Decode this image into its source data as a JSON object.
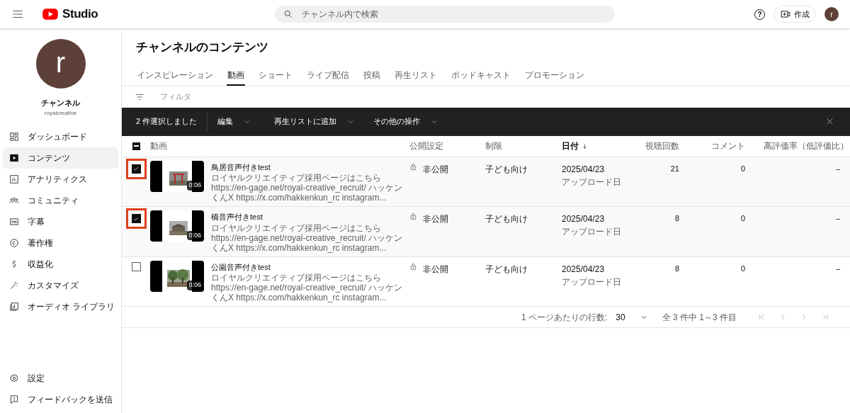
{
  "topbar": {
    "logo": "Studio",
    "search_placeholder": "チャンネル内で検索",
    "help_symbol": "?",
    "create_label": "作成",
    "avatar_letter": "r"
  },
  "channel": {
    "avatar_letter": "r",
    "name": "チャンネル",
    "handle": "royalcreative"
  },
  "sidebar": {
    "items": [
      {
        "label": "ダッシュボード",
        "selected": false
      },
      {
        "label": "コンテンツ",
        "selected": true
      },
      {
        "label": "アナリティクス",
        "selected": false
      },
      {
        "label": "コミュニティ",
        "selected": false
      },
      {
        "label": "字幕",
        "selected": false
      },
      {
        "label": "著作権",
        "selected": false
      },
      {
        "label": "収益化",
        "selected": false
      },
      {
        "label": "カスタマイズ",
        "selected": false
      },
      {
        "label": "オーディオ ライブラリ",
        "selected": false
      }
    ],
    "footer_items": [
      {
        "label": "設定"
      },
      {
        "label": "フィードバックを送信"
      }
    ]
  },
  "page_title": "チャンネルのコンテンツ",
  "tabs": [
    {
      "label": "インスピレーション",
      "selected": false
    },
    {
      "label": "動画",
      "selected": true
    },
    {
      "label": "ショート",
      "selected": false
    },
    {
      "label": "ライブ配信",
      "selected": false
    },
    {
      "label": "投稿",
      "selected": false
    },
    {
      "label": "再生リスト",
      "selected": false
    },
    {
      "label": "ポッドキャスト",
      "selected": false
    },
    {
      "label": "プロモーション",
      "selected": false
    }
  ],
  "filter_placeholder": "フィルタ",
  "selection_bar": {
    "count_label": "2 件選択しました",
    "actions": [
      "編集",
      "再生リストに追加",
      "その他の操作"
    ]
  },
  "table": {
    "header_checkbox": {
      "indeterminate": true
    },
    "columns": [
      {
        "label": "動画",
        "sorted": false
      },
      {
        "label": "公開設定",
        "sorted": false
      },
      {
        "label": "制限",
        "sorted": false
      },
      {
        "label": "日付",
        "sorted": true
      },
      {
        "label": "視聴回数",
        "sorted": false
      },
      {
        "label": "コメント",
        "sorted": false
      },
      {
        "label": "高評価率（低評価比）",
        "sorted": false
      }
    ],
    "rows": [
      {
        "checked": true,
        "highlighted": true,
        "duration": "0:06",
        "title": "鳥居音声付きtest",
        "description": "ロイヤルクリエイティブ採用ページはこちら https://en-gage.net/royal-creative_recruit/ ハッケンくんX https://x.com/hakkenkun_rc instagram...",
        "visibility": "非公開",
        "restriction": "子ども向け",
        "date": "2025/04/23",
        "date_label": "アップロード日",
        "views": "21",
        "comments": "0",
        "rating": "–"
      },
      {
        "checked": true,
        "highlighted": true,
        "duration": "0:06",
        "title": "橋音声付きtest",
        "description": "ロイヤルクリエイティブ採用ページはこちら https://en-gage.net/royal-creative_recruit/ ハッケンくんX https://x.com/hakkenkun_rc instagram...",
        "visibility": "非公開",
        "restriction": "子ども向け",
        "date": "2025/04/23",
        "date_label": "アップロード日",
        "views": "8",
        "comments": "0",
        "rating": "–"
      },
      {
        "checked": false,
        "highlighted": false,
        "duration": "0:06",
        "title": "公園音声付きtest",
        "description": "ロイヤルクリエイティブ採用ページはこちら https://en-gage.net/royal-creative_recruit/ ハッケンくんX https://x.com/hakkenkun_rc instagram...",
        "visibility": "非公開",
        "restriction": "子ども向け",
        "date": "2025/04/23",
        "date_label": "アップロード日",
        "views": "8",
        "comments": "0",
        "rating": "–"
      }
    ]
  },
  "pagination": {
    "rows_per_page_label": "1 ページあたりの行数:",
    "rows_per_page": "30",
    "range": "全 3 件中 1～3 件目"
  }
}
